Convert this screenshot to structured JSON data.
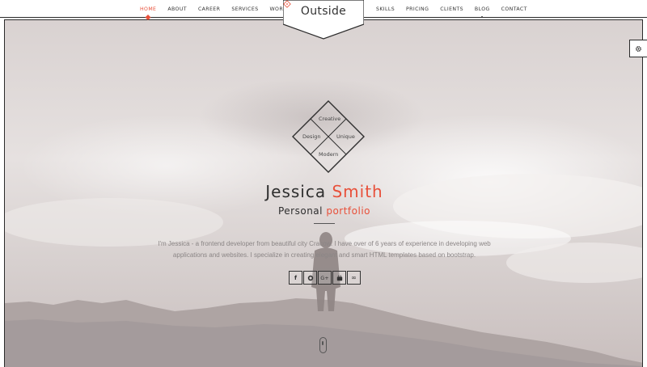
{
  "nav": {
    "left": [
      {
        "label": "HOME",
        "active": true
      },
      {
        "label": "ABOUT"
      },
      {
        "label": "CAREER"
      },
      {
        "label": "SERVICES"
      },
      {
        "label": "WORKS"
      }
    ],
    "right": [
      {
        "label": "SKILLS"
      },
      {
        "label": "PRICING"
      },
      {
        "label": "CLIENTS"
      },
      {
        "label": "BLOG"
      },
      {
        "label": "CONTACT"
      }
    ]
  },
  "logo": {
    "text": "Outside"
  },
  "emblem": {
    "top": "Creative",
    "left": "Design",
    "right": "Unique",
    "bottom": "Modern"
  },
  "hero": {
    "name_first": "Jessica",
    "name_last": "Smith",
    "subtitle_main": "Personal",
    "subtitle_accent": "portfolio",
    "intro": "I'm Jessica - a frontend developer from beautiful city Cracow. I have over of 6 years of experience in developing web applications and websites. I specialize in creating elegant and smart HTML templates based on bootstrap."
  },
  "socials": [
    {
      "icon": "facebook-icon",
      "glyph": "f"
    },
    {
      "icon": "github-icon",
      "glyph": ""
    },
    {
      "icon": "google-plus-icon",
      "glyph": "G+"
    },
    {
      "icon": "youtube-icon",
      "glyph": ""
    },
    {
      "icon": "lastfm-icon",
      "glyph": "∞"
    }
  ],
  "colors": {
    "accent": "#e8503a",
    "dark": "#2b2b2b"
  },
  "settings": {
    "icon": "gear-icon"
  }
}
